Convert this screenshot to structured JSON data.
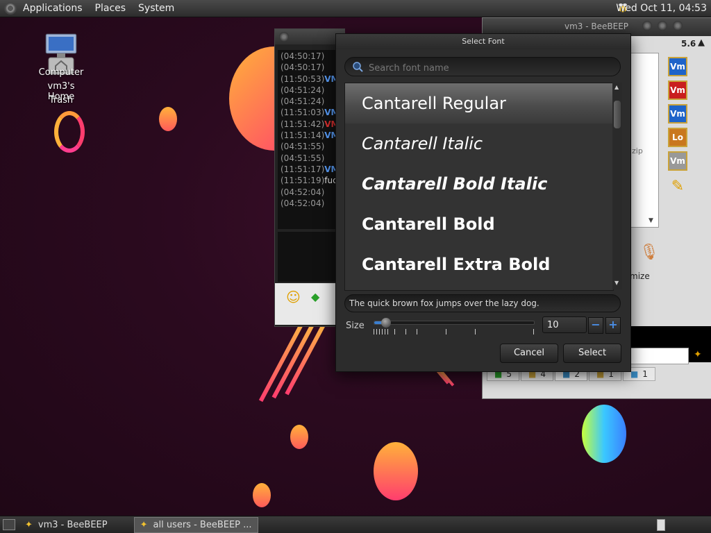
{
  "top_panel": {
    "menus": [
      "Applications",
      "Places",
      "System"
    ],
    "clock": "Wed Oct 11, 04:53"
  },
  "desktop_icons": [
    {
      "label": "Computer",
      "overlay_label": "vm3's Home"
    },
    {
      "label": "Trash"
    }
  ],
  "chat_window": {
    "times": [
      "(04:50:17)",
      "(04:50:17)",
      "(11:50:53)",
      "(04:51:24)",
      "(04:51:24)",
      "(11:51:03)",
      "(11:51:42)",
      "(11:51:14)",
      "(04:51:55)",
      "(04:51:55)",
      "(11:51:17)",
      "(11:51:19)",
      "(04:52:04)",
      "(04:52:04)"
    ],
    "users": [
      "",
      "",
      "VM",
      "",
      "",
      "VM",
      "VM",
      "VM",
      "",
      "",
      "VM",
      "fuc",
      "",
      ""
    ]
  },
  "right_window": {
    "title_fragment": "vm3 - BeeBEEP",
    "version_fragment": "5.6",
    "side_buttons": [
      "Vm",
      "Vm",
      "Vm",
      "Lo",
      "Vm"
    ],
    "zip_fragment": "zip",
    "mize_fragment": "mize",
    "tabs": [
      "5",
      "4",
      "2",
      "1",
      "1"
    ]
  },
  "dialog": {
    "title": "Select Font",
    "search_placeholder": "Search font name",
    "fonts": [
      {
        "name": "Cantarell Regular",
        "style": "normal",
        "weight": "normal"
      },
      {
        "name": "Cantarell Italic",
        "style": "italic",
        "weight": "normal"
      },
      {
        "name": "Cantarell Bold Italic",
        "style": "italic",
        "weight": "bold"
      },
      {
        "name": "Cantarell Bold",
        "style": "normal",
        "weight": "bold"
      },
      {
        "name": "Cantarell Extra Bold",
        "style": "normal",
        "weight": "bold"
      }
    ],
    "selected_index": 0,
    "preview_text": "The quick brown fox jumps over the lazy dog.",
    "size_label": "Size",
    "size_value": "10",
    "slider_fraction": 0.05,
    "cancel_label": "Cancel",
    "select_label": "Select"
  },
  "taskbar": {
    "tasks": [
      "vm3 - BeeBEEP",
      "all users - BeeBEEP ..."
    ],
    "active_index": 1
  },
  "colors": {
    "accent": "#3b7fd0",
    "vm_blue": "#1e63c9",
    "vm_red": "#c91e1e"
  }
}
